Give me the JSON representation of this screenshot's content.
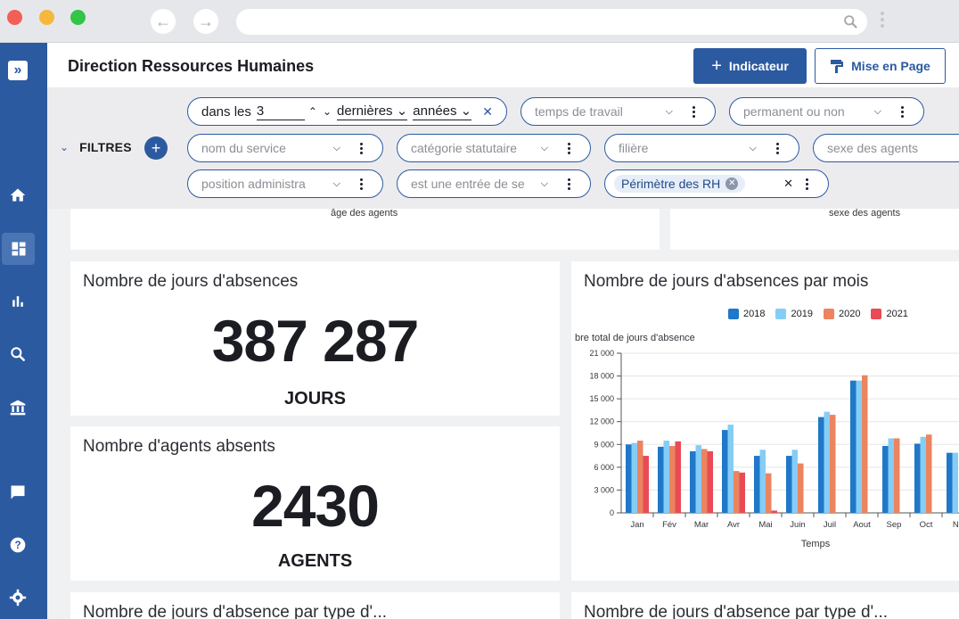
{
  "header": {
    "title": "Direction Ressources Humaines",
    "add_indicator_label": "Indicateur",
    "layout_button_label": "Mise en Page"
  },
  "filters": {
    "label": "FILTRES",
    "date": {
      "prefix": "dans les",
      "count": "3",
      "relative": "dernières",
      "unit": "années"
    },
    "dropdowns": [
      "temps de travail",
      "permanent ou non",
      "nom du service",
      "catégorie statutaire",
      "filière",
      "sexe des agents",
      "position administra",
      "est une entrée de se"
    ],
    "perimeter_chip": "Périmètre des RH"
  },
  "top_cards": {
    "left_axis_label": "âge des agents",
    "right_axis_label": "sexe des agents"
  },
  "kpi_absence_days": {
    "title": "Nombre de jours d'absences",
    "value": "387 287",
    "unit": "JOURS"
  },
  "kpi_absent_agents": {
    "title": "Nombre d'agents absents",
    "value": "2430",
    "unit": "AGENTS"
  },
  "monthly_chart": {
    "title": "Nombre de jours d'absences par mois",
    "legend_colors": [
      "#1f78c8",
      "#86cdf5",
      "#eb845f",
      "#e84b55"
    ]
  },
  "bottom_cards": {
    "left_title": "Nombre de jours d'absence par type d'...",
    "right_title": "Nombre de jours d'absence par type d'..."
  },
  "chart_data": {
    "type": "bar",
    "title": "Nombre de jours d'absences par mois",
    "ylabel": "bre total de jours d'absence",
    "xlabel": "Temps",
    "ylim": [
      0,
      21000
    ],
    "yticks": [
      "0",
      "3 000",
      "6 000",
      "9 000",
      "12 000",
      "15 000",
      "18 000",
      "21 000"
    ],
    "categories": [
      "Jan",
      "Fév",
      "Mar",
      "Avr",
      "Mai",
      "Juin",
      "Juil",
      "Aout",
      "Sep",
      "Oct",
      "No"
    ],
    "series": [
      {
        "name": "2018",
        "values": [
          9000,
          8700,
          8100,
          10900,
          7500,
          7500,
          12600,
          17400,
          8800,
          9100,
          7900
        ]
      },
      {
        "name": "2019",
        "values": [
          9200,
          9500,
          8900,
          11600,
          8300,
          8300,
          13300,
          17400,
          9800,
          10000,
          7900
        ]
      },
      {
        "name": "2020",
        "values": [
          9500,
          8800,
          8400,
          5500,
          5200,
          6500,
          12900,
          18100,
          9800,
          10300,
          null
        ]
      },
      {
        "name": "2021",
        "values": [
          7500,
          9400,
          8100,
          5300,
          300,
          null,
          null,
          null,
          null,
          null,
          null
        ]
      }
    ]
  }
}
